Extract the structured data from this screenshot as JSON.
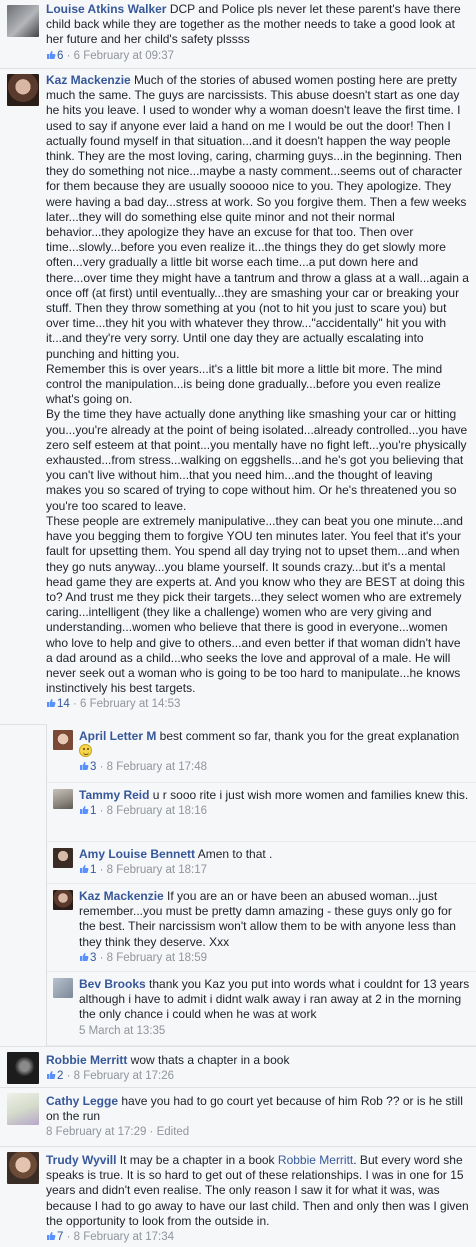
{
  "comments": [
    {
      "name": "Louise Atkins Walker",
      "text": " DCP and Police pls never let these parent's have there child back while they are together as the mother needs to take a good look at her future and her child's safety plssss",
      "likes": "6",
      "time": "6 February at 09:37"
    },
    {
      "name": "Kaz Mackenzie",
      "text": " Much of the stories of abused women posting here are pretty much the same. The guys are narcissists. This abuse doesn't start as one day he hits you leave. I used to wonder why a woman doesn't leave the first time. I used to say if anyone ever laid a hand on me I would be out the door! Then I actually found myself in that situation...and it doesn't happen the way people think. They are the most loving, caring, charming guys...in the beginning. Then they do something not nice...maybe a nasty comment...seems out of character for them because they are usually sooooo nice to you. They apologize. They were having a bad day...stress at work. So you forgive them. Then a few weeks later...they will do something else quite minor and not their normal behavior...they apologize they have an excuse for that too. Then over time...slowly...before you even realize it...the things they do get slowly more often...very gradually a little bit worse each time...a put down here and there...over time they might have a tantrum and throw a glass at a wall...again a once off (at first) until eventually...they are smashing your car or breaking your stuff. Then they throw something at you (not to hit you just to scare you) but over time...they hit you with whatever they throw...\"accidentally\" hit you with it...and they're very sorry. Until one day they are actually escalating into punching and hitting you.\nRemember this is over years...it's a little bit more a little bit more. The mind control the manipulation...is being done gradually...before you even realize what's going on.\nBy the time they have actually done anything like smashing your car or hitting you...you're already at the point of being isolated...already controlled...you have zero self esteem at that point...you mentally have no fight left...you're physically exhausted...from stress...walking on eggshells...and he's got you believing that you can't live without him...that you need him...and the thought of leaving makes you so scared of trying to cope without him. Or he's threatened you so you're too scared to leave.\nThese people are extremely manipulative...they can beat you one minute...and have you begging them to forgive YOU ten minutes later. You feel that it's your fault for upsetting them. You spend all day trying not to upset them...and when they go nuts anyway...you blame yourself. It sounds crazy...but it's a mental head game they are experts at. And you know who they are BEST at doing this to? And trust me they pick their targets...they select women who are extremely caring...intelligent (they like a challenge) women who are very giving and understanding...women who believe that there is good in everyone...women who love to help and give to others...and even better if that woman didn't have a dad around as a child...who seeks the love and approval of a male. He will never seek out a woman who is going to be too hard to manipulate...he knows instinctively his best targets.",
      "likes": "14",
      "time": "6 February at 14:53",
      "replies": [
        {
          "name": "April Letter M",
          "text": " best comment so far, thank you for the great explanation ",
          "emoji": true,
          "likes": "3",
          "time": "8 February at 17:48"
        },
        {
          "name": "Tammy Reid",
          "text": " u r sooo rite i just wish more women and families knew this.",
          "likes": "1",
          "time": "8 February at 18:16"
        },
        {
          "name": "Amy Louise Bennett",
          "text": " Amen to that .",
          "likes": "1",
          "time": "8 February at 18:17"
        },
        {
          "name": "Kaz Mackenzie",
          "text": " If you are an or have been an abused woman...just remember...you must be pretty damn amazing - these guys only go for the best. Their narcissism won't allow them to be with anyone less than they think they deserve. Xxx",
          "likes": "3",
          "time": "8 February at 18:59"
        },
        {
          "name": "Bev Brooks",
          "text": " thank you Kaz you put into words what i couldnt for 13 years although i have to admit i didnt walk away i ran away at 2 in the morning the only chance i could when he was at work",
          "likes": "",
          "time": "5 March at 13:35"
        }
      ]
    },
    {
      "name": "Robbie Merritt",
      "text": " wow thats a chapter in a book",
      "likes": "2",
      "time": "8 February at 17:26"
    },
    {
      "name": "Cathy Legge",
      "text": " have you had to go court yet because of him Rob ?? or is he still on the run",
      "likes": "",
      "time": "8 February at 17:29 · Edited"
    },
    {
      "name": "Trudy Wyvill",
      "text_pre": " It may be a chapter in a book ",
      "mention": "Robbie Merritt",
      "text": ". But every word she speaks is true. It is so hard to get out of these relationships. I was in one for 15 years and didn't even realise. The only reason I saw it for what it was, was because I had to go away to have our last child. Then and only then was I given the opportunity to look from the outside in.",
      "likes": "7",
      "time": "8 February at 17:34"
    }
  ],
  "colors": {
    "link": "#365899",
    "meta": "#90949c",
    "bg": "#f6f7f9"
  },
  "icons": {
    "like": "thumbs-up-icon",
    "emoji": "smiley-emoji-icon"
  }
}
